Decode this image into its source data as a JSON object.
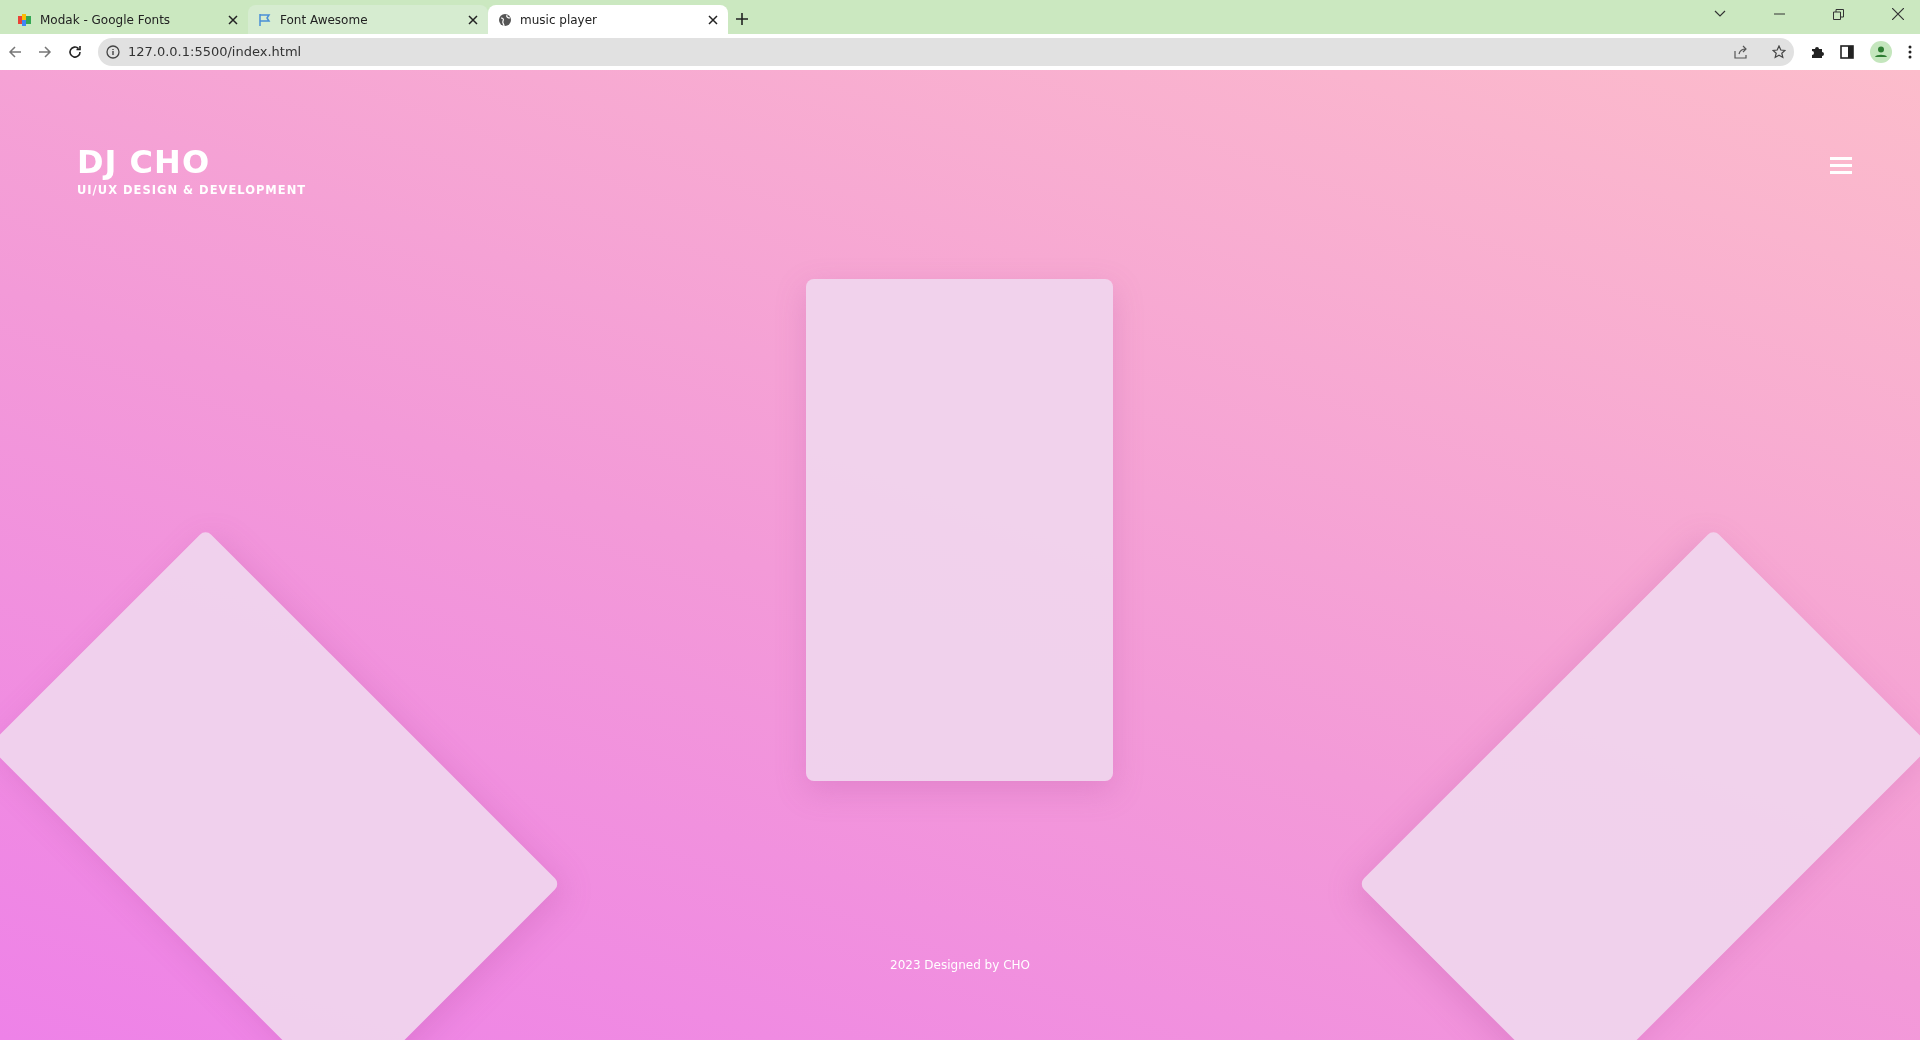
{
  "browser": {
    "tabs": [
      {
        "title": "Modak - Google Fonts",
        "kind": "google",
        "selected": false
      },
      {
        "title": "Font Awesome",
        "kind": "flag",
        "selected": false
      },
      {
        "title": "music player",
        "kind": "globe",
        "selected": true
      }
    ],
    "address": "127.0.0.1:5500/index.html"
  },
  "header": {
    "logo": "DJ CHO",
    "tagline": "UI/UX DESIGN & DEVELOPMENT"
  },
  "footer": "2023 Designed by CHO"
}
